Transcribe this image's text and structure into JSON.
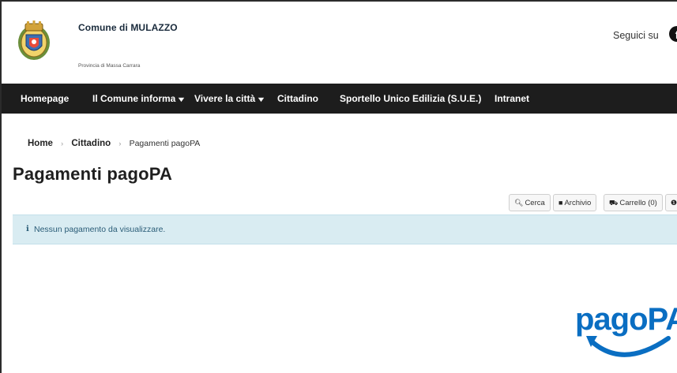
{
  "header": {
    "site_name": "Comune di MULAZZO",
    "site_sub": "Provincia di Massa Carrara",
    "follow_label": "Seguici su",
    "social_icon": "facebook-icon"
  },
  "nav": {
    "items": [
      {
        "label": "Homepage",
        "dropdown": false
      },
      {
        "label": "Il Comune informa",
        "dropdown": true
      },
      {
        "label": "Vivere la città",
        "dropdown": true
      },
      {
        "label": "Cittadino",
        "dropdown": false
      },
      {
        "label": "Sportello Unico Edilizia (S.U.E.)",
        "dropdown": false
      },
      {
        "label": "Intranet",
        "dropdown": false
      }
    ]
  },
  "breadcrumb": {
    "home": "Home",
    "parent": "Cittadino",
    "current": "Pagamenti pagoPA"
  },
  "page": {
    "title": "Pagamenti pagoPA"
  },
  "toolbar": {
    "search_label": "Cerca",
    "archive_label": "Archivio",
    "cart_label": "Carrello (0)"
  },
  "alert": {
    "text": "Nessun pagamento da visualizzare."
  },
  "logo": {
    "text": "pagoPA"
  },
  "colors": {
    "nav_bg": "#1d1d1d",
    "alert_bg": "#d9ecf2",
    "alert_text": "#2a5c77",
    "pagopa_blue": "#0a6ec2"
  }
}
